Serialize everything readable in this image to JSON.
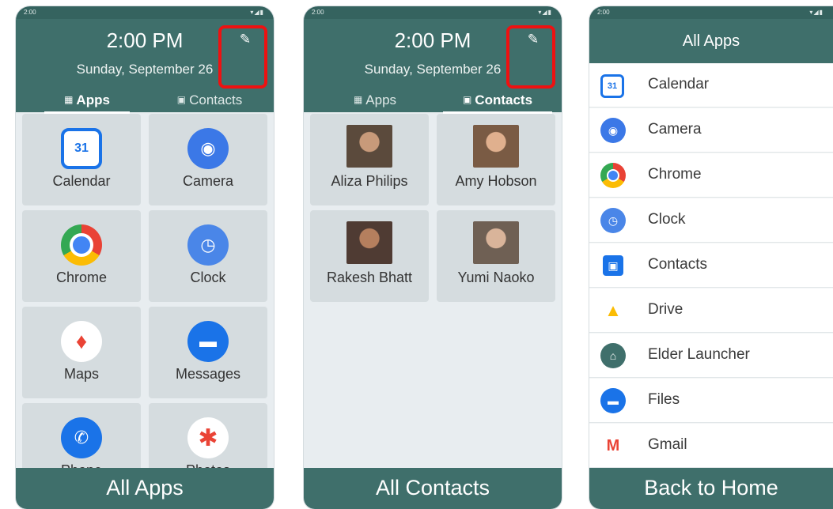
{
  "phones": [
    {
      "status": {
        "time": "2:00",
        "icons": "▾◢▮"
      },
      "clock": "2:00 PM",
      "date": "Sunday, September 26",
      "tabs": [
        {
          "label": "Apps",
          "icon": "apps-grid-icon",
          "active": true
        },
        {
          "label": "Contacts",
          "icon": "contacts-icon",
          "active": false
        }
      ],
      "apps": [
        {
          "label": "Calendar",
          "icon": "calendar-icon",
          "color": "#1a73e8",
          "glyph": "31"
        },
        {
          "label": "Camera",
          "icon": "camera-icon",
          "color": "#3b78e7",
          "glyph": "◉"
        },
        {
          "label": "Chrome",
          "icon": "chrome-icon",
          "color": "#e94235",
          "glyph": "●"
        },
        {
          "label": "Clock",
          "icon": "clock-icon",
          "color": "#4a86e8",
          "glyph": "◷"
        },
        {
          "label": "Maps",
          "icon": "maps-icon",
          "color": "#ffffff",
          "glyph": "♦"
        },
        {
          "label": "Messages",
          "icon": "messages-icon",
          "color": "#1a73e8",
          "glyph": "▬"
        },
        {
          "label": "Phone",
          "icon": "phone-icon",
          "color": "#1a73e8",
          "glyph": "✆"
        },
        {
          "label": "Photos",
          "icon": "photos-icon",
          "color": "#ffffff",
          "glyph": "✱"
        }
      ],
      "footer": "All Apps"
    },
    {
      "status": {
        "time": "2:00",
        "icons": "▾◢▮"
      },
      "clock": "2:00 PM",
      "date": "Sunday, September 26",
      "tabs": [
        {
          "label": "Apps",
          "icon": "apps-grid-icon",
          "active": false
        },
        {
          "label": "Contacts",
          "icon": "contacts-icon",
          "active": true
        }
      ],
      "contacts": [
        {
          "name": "Aliza Philips",
          "photo_color": "#5b4a3c"
        },
        {
          "name": "Amy Hobson",
          "photo_color": "#7a5b44"
        },
        {
          "name": "Rakesh Bhatt",
          "photo_color": "#4f3b33"
        },
        {
          "name": "Yumi Naoko",
          "photo_color": "#6f6054"
        }
      ],
      "footer": "All Contacts"
    },
    {
      "status": {
        "time": "2:00",
        "icons": "▾◢▮"
      },
      "title": "All Apps",
      "apps": [
        {
          "label": "Calendar",
          "icon": "calendar-icon",
          "color": "#1a73e8",
          "glyph": "31"
        },
        {
          "label": "Camera",
          "icon": "camera-icon",
          "color": "#3b78e7",
          "glyph": "◉"
        },
        {
          "label": "Chrome",
          "icon": "chrome-icon",
          "color": "#e94235",
          "glyph": "●"
        },
        {
          "label": "Clock",
          "icon": "clock-icon",
          "color": "#4a86e8",
          "glyph": "◷"
        },
        {
          "label": "Contacts",
          "icon": "contacts-icon",
          "color": "#1a73e8",
          "glyph": "▣"
        },
        {
          "label": "Drive",
          "icon": "drive-icon",
          "color": "#fbbc04",
          "glyph": "▲"
        },
        {
          "label": "Elder Launcher",
          "icon": "elder-launcher-icon",
          "color": "#3f6f6b",
          "glyph": "⌂"
        },
        {
          "label": "Files",
          "icon": "files-icon",
          "color": "#1a73e8",
          "glyph": "▬"
        },
        {
          "label": "Gmail",
          "icon": "gmail-icon",
          "color": "#ffffff",
          "glyph": "M"
        }
      ],
      "footer": "Back to Home"
    }
  ],
  "edit_icon": "edit-pencil-icon",
  "accent": "#3f6f6b",
  "highlight_color": "#ee1111"
}
